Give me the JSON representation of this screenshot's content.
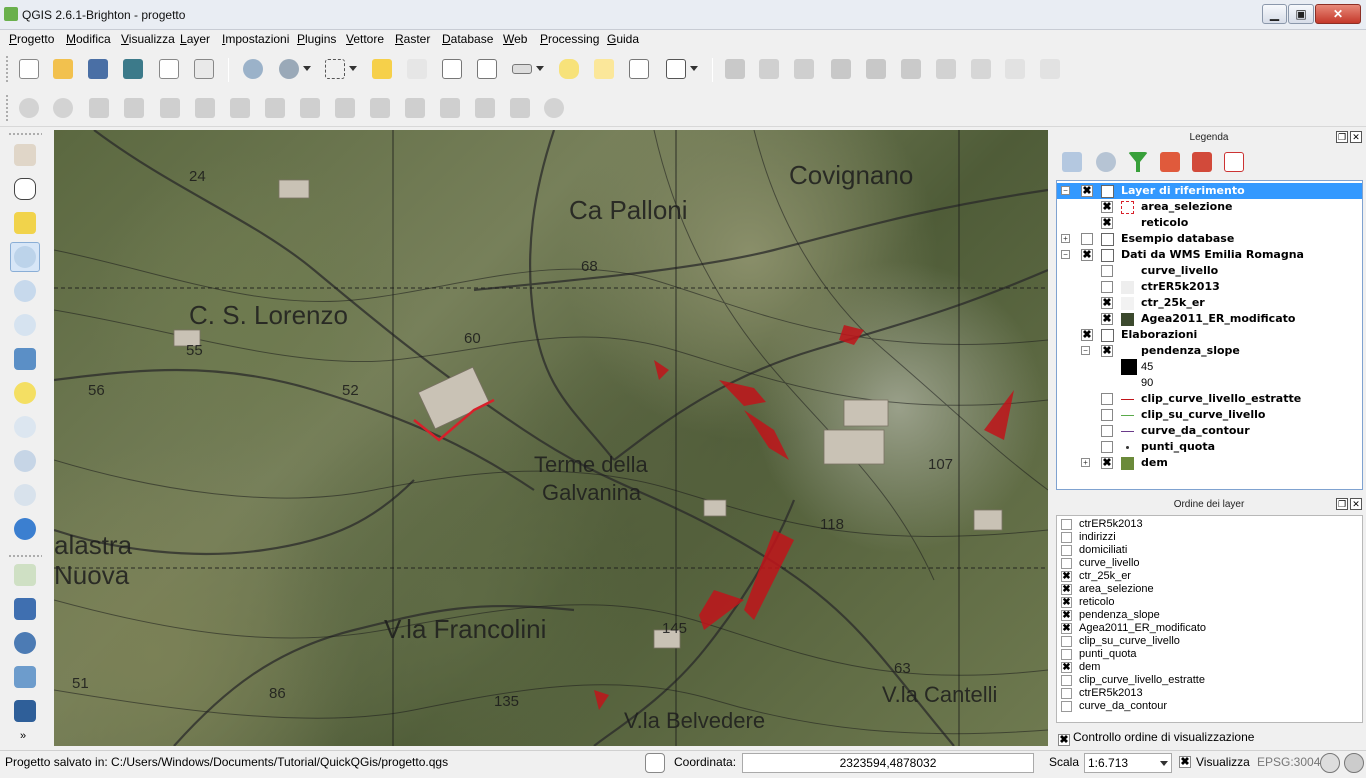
{
  "window": {
    "title": "QGIS 2.6.1-Brighton - progetto"
  },
  "menu": [
    {
      "label": "Progetto",
      "key": "P",
      "rest": "rogetto"
    },
    {
      "label": "Modifica",
      "key": "M",
      "rest": "odifica"
    },
    {
      "label": "Visualizza",
      "key": "V",
      "rest": "isualizza"
    },
    {
      "label": "Layer",
      "key": "L",
      "rest": "ayer"
    },
    {
      "label": "Impostazioni",
      "key": "I",
      "rest": "mpostazioni"
    },
    {
      "label": "Plugins",
      "key": "P",
      "rest": "lugins"
    },
    {
      "label": "Vettore",
      "key": "V",
      "rest": "ettore"
    },
    {
      "label": "Raster",
      "key": "R",
      "rest": "aster"
    },
    {
      "label": "Database",
      "key": "D",
      "rest": "atabase"
    },
    {
      "label": "Web",
      "key": "W",
      "rest": "eb"
    },
    {
      "label": "Processing",
      "key": "P",
      "rest": "rocessing"
    },
    {
      "label": "Guida",
      "key": "G",
      "rest": "uida"
    }
  ],
  "map": {
    "labels": [
      "Covignano",
      "Ca Palloni",
      "C. S. Lorenzo",
      "Terme della",
      "Galvanina",
      "alastra",
      "Nuova",
      "V.la Francolini",
      "V.la Belvedere",
      "V.la Cantelli"
    ],
    "numbers": [
      "24",
      "68",
      "60",
      "55",
      "52",
      "56",
      "118",
      "107",
      "145",
      "51",
      "86",
      "135",
      "63"
    ]
  },
  "legend": {
    "title": "Legenda",
    "items": [
      {
        "label": "Layer di riferimento",
        "checked": "✖",
        "expanded": "−"
      },
      {
        "label": "area_selezione",
        "checked": "✖"
      },
      {
        "label": "reticolo",
        "checked": "✖"
      },
      {
        "label": "Esempio database",
        "checked": "",
        "expanded": "+"
      },
      {
        "label": "Dati da WMS Emilia Romagna",
        "checked": "✖",
        "expanded": "−"
      },
      {
        "label": "curve_livello",
        "checked": ""
      },
      {
        "label": "ctrER5k2013",
        "checked": ""
      },
      {
        "label": "ctr_25k_er",
        "checked": "✖"
      },
      {
        "label": "Agea2011_ER_modificato",
        "checked": "✖"
      },
      {
        "label": "Elaborazioni",
        "checked": "✖",
        "expanded": "−"
      },
      {
        "label": "pendenza_slope",
        "checked": "✖",
        "expanded": "−"
      },
      {
        "label": "45"
      },
      {
        "label": "90"
      },
      {
        "label": "clip_curve_livello_estratte",
        "checked": ""
      },
      {
        "label": "clip_su_curve_livello",
        "checked": ""
      },
      {
        "label": "curve_da_contour",
        "checked": ""
      },
      {
        "label": "punti_quota",
        "checked": ""
      },
      {
        "label": "dem",
        "checked": "✖",
        "expanded": "+"
      }
    ]
  },
  "layer_order": {
    "title": "Ordine dei layer",
    "items": [
      {
        "label": "ctrER5k2013",
        "checked": ""
      },
      {
        "label": "indirizzi",
        "checked": ""
      },
      {
        "label": "domiciliati",
        "checked": ""
      },
      {
        "label": "curve_livello",
        "checked": ""
      },
      {
        "label": "ctr_25k_er",
        "checked": "✖"
      },
      {
        "label": "area_selezione",
        "checked": "✖"
      },
      {
        "label": "reticolo",
        "checked": "✖"
      },
      {
        "label": "pendenza_slope",
        "checked": "✖"
      },
      {
        "label": "Agea2011_ER_modificato",
        "checked": "✖"
      },
      {
        "label": "clip_su_curve_livello",
        "checked": ""
      },
      {
        "label": "punti_quota",
        "checked": ""
      },
      {
        "label": "dem",
        "checked": "✖"
      },
      {
        "label": "clip_curve_livello_estratte",
        "checked": ""
      },
      {
        "label": "ctrER5k2013",
        "checked": ""
      },
      {
        "label": "curve_da_contour",
        "checked": ""
      }
    ],
    "control_label": "Controllo ordine di visualizzazione",
    "control_checked": "✖"
  },
  "status": {
    "message": "Progetto salvato in: C:/Users/Windows/Documents/Tutorial/QuickQGis/progetto.qgs",
    "coord_label": "Coordinata:",
    "coord_value": "2323594,4878032",
    "scale_label": "Scala",
    "scale_value": "1:6.713",
    "render_label": "Visualizza",
    "render_checked": "✖",
    "epsg": "EPSG:3004"
  },
  "colors": {
    "accent": "#3399ff",
    "slope_red": "#c0141a",
    "selection_red": "#d8202a"
  }
}
